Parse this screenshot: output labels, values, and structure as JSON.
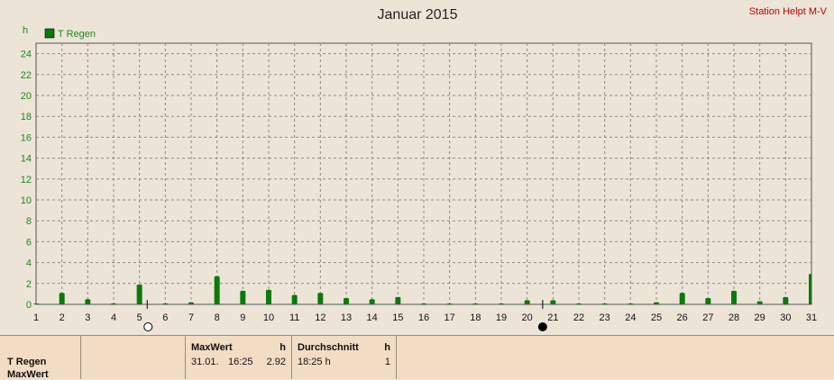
{
  "chart_data": {
    "type": "bar",
    "title": "Januar 2015",
    "station": "Station Helpt M-V",
    "ylabel": "h",
    "ylim": [
      0,
      25
    ],
    "yticks": [
      0,
      2,
      4,
      6,
      8,
      10,
      12,
      14,
      16,
      18,
      20,
      22,
      24
    ],
    "categories": [
      "1",
      "2",
      "3",
      "4",
      "5",
      "6",
      "7",
      "8",
      "9",
      "10",
      "11",
      "12",
      "13",
      "14",
      "15",
      "16",
      "17",
      "18",
      "19",
      "20",
      "21",
      "22",
      "23",
      "24",
      "25",
      "26",
      "27",
      "28",
      "29",
      "30",
      "31"
    ],
    "series": [
      {
        "name": "T Regen",
        "color": "#0a7a0a",
        "values": [
          0.05,
          1.1,
          0.5,
          0.1,
          1.9,
          0.1,
          0.2,
          2.7,
          1.3,
          1.4,
          0.9,
          1.1,
          0.6,
          0.5,
          0.7,
          0.05,
          0.05,
          0.05,
          0.05,
          0.4,
          0.4,
          0.05,
          0.05,
          0.05,
          0.2,
          1.1,
          0.6,
          1.3,
          0.3,
          0.7,
          2.92
        ]
      }
    ],
    "grid": true,
    "legend_position": "top-left",
    "moon_phases": [
      {
        "day": 5.3,
        "phase": "full-moon-icon"
      },
      {
        "day": 20.6,
        "phase": "new-moon-icon"
      }
    ]
  },
  "info_panel": {
    "series_label": "T Regen",
    "row2_label": "MaxWert",
    "max_header": "MaxWert",
    "max_unit": "h",
    "max_date": "31.01.",
    "max_time": "16:25",
    "max_value": "2.92",
    "avg_header": "Durchschnitt",
    "avg_unit": "h",
    "avg_time": "18:25 h",
    "avg_value": "1"
  }
}
